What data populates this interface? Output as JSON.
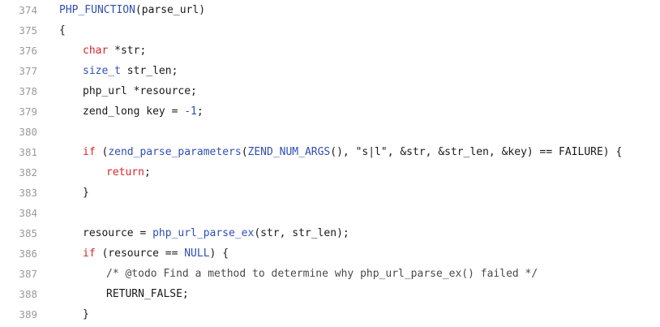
{
  "lines": [
    {
      "number": "374",
      "indent": 0,
      "tokens": [
        {
          "t": "PHP_FUNCTION",
          "c": "fn"
        },
        {
          "t": "(parse_url)",
          "c": "plain"
        }
      ]
    },
    {
      "number": "375",
      "indent": 0,
      "tokens": [
        {
          "t": "{",
          "c": "plain"
        }
      ]
    },
    {
      "number": "376",
      "indent": 1,
      "tokens": [
        {
          "t": "char",
          "c": "kw"
        },
        {
          "t": " *str;",
          "c": "plain"
        }
      ]
    },
    {
      "number": "377",
      "indent": 1,
      "tokens": [
        {
          "t": "size_t",
          "c": "fn"
        },
        {
          "t": " str_len;",
          "c": "plain"
        }
      ]
    },
    {
      "number": "378",
      "indent": 1,
      "tokens": [
        {
          "t": "php_url *resource;",
          "c": "plain"
        }
      ]
    },
    {
      "number": "379",
      "indent": 1,
      "tokens": [
        {
          "t": "zend_long key = ",
          "c": "plain"
        },
        {
          "t": "-1",
          "c": "num"
        },
        {
          "t": ";",
          "c": "plain"
        }
      ]
    },
    {
      "number": "380",
      "indent": 0,
      "tokens": []
    },
    {
      "number": "381",
      "indent": 1,
      "tokens": [
        {
          "t": "if",
          "c": "kw"
        },
        {
          "t": " (",
          "c": "plain"
        },
        {
          "t": "zend_parse_parameters",
          "c": "fn"
        },
        {
          "t": "(",
          "c": "plain"
        },
        {
          "t": "ZEND_NUM_ARGS",
          "c": "fn"
        },
        {
          "t": "(), \"s|l\", &str, &str_len, &key) == FAILURE) {",
          "c": "plain"
        }
      ]
    },
    {
      "number": "382",
      "indent": 2,
      "tokens": [
        {
          "t": "return",
          "c": "kw"
        },
        {
          "t": ";",
          "c": "plain"
        }
      ]
    },
    {
      "number": "383",
      "indent": 1,
      "tokens": [
        {
          "t": "}",
          "c": "plain"
        }
      ]
    },
    {
      "number": "384",
      "indent": 0,
      "tokens": []
    },
    {
      "number": "385",
      "indent": 1,
      "tokens": [
        {
          "t": "resource = ",
          "c": "plain"
        },
        {
          "t": "php_url_parse_ex",
          "c": "fn"
        },
        {
          "t": "(str, str_len);",
          "c": "plain"
        }
      ]
    },
    {
      "number": "386",
      "indent": 1,
      "tokens": [
        {
          "t": "if",
          "c": "kw"
        },
        {
          "t": " (resource == ",
          "c": "plain"
        },
        {
          "t": "NULL",
          "c": "const"
        },
        {
          "t": ") {",
          "c": "plain"
        }
      ]
    },
    {
      "number": "387",
      "indent": 2,
      "tokens": [
        {
          "t": "/* @todo Find a method to determine why php_url_parse_ex() failed */",
          "c": "comment"
        }
      ]
    },
    {
      "number": "388",
      "indent": 2,
      "tokens": [
        {
          "t": "RETURN_FALSE;",
          "c": "plain"
        }
      ]
    },
    {
      "number": "389",
      "indent": 1,
      "tokens": [
        {
          "t": "}",
          "c": "plain"
        }
      ]
    }
  ]
}
